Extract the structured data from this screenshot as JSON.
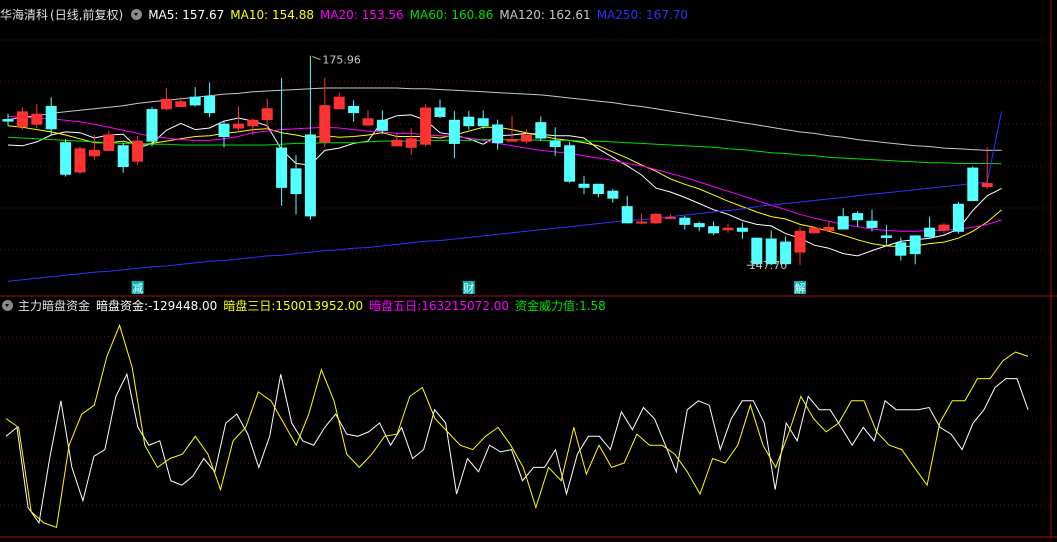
{
  "main_header": {
    "title": "华海清科",
    "mode": "(日线,前复权)",
    "indicators": [
      {
        "label": "MA5",
        "value": "157.67",
        "color": "#ffffff"
      },
      {
        "label": "MA10",
        "value": "154.88",
        "color": "#ffff00"
      },
      {
        "label": "MA20",
        "value": "153.56",
        "color": "#ff00ff"
      },
      {
        "label": "MA60",
        "value": "160.86",
        "color": "#00e000"
      },
      {
        "label": "MA120",
        "value": "162.61",
        "color": "#c8c8c8"
      },
      {
        "label": "MA250",
        "value": "167.70",
        "color": "#3030ff"
      }
    ]
  },
  "sub_header": {
    "title": "主力暗盘资金",
    "indicators": [
      {
        "label": "暗盘资金",
        "value": "-129448.00",
        "color": "#ffffff"
      },
      {
        "label": "暗盘三日",
        "value": "150013952.00",
        "color": "#ffff00"
      },
      {
        "label": "暗盘五日",
        "value": "163215072.00",
        "color": "#ff00ff"
      },
      {
        "label": "资金威力值",
        "value": "1.58",
        "color": "#00e000"
      }
    ]
  },
  "markers": [
    {
      "text": "减",
      "index": 9
    },
    {
      "text": "财",
      "index": 32
    },
    {
      "text": "解",
      "index": 55
    }
  ],
  "chart_data": [
    {
      "type": "candlestick",
      "high_annotation": "175.96",
      "low_annotation": "147.70",
      "ylim": [
        145.0,
        179.0
      ],
      "grid": true,
      "candles": [
        [
          166.6,
          166.4,
          167.4,
          165.8
        ],
        [
          165.7,
          167.6,
          168.2,
          165.3
        ],
        [
          166.0,
          167.3,
          168.6,
          165.5
        ],
        [
          168.3,
          165.4,
          169.5,
          164.5
        ],
        [
          163.6,
          159.5,
          164.1,
          159.2
        ],
        [
          159.8,
          162.8,
          163.1,
          159.5
        ],
        [
          161.9,
          162.6,
          164.6,
          161.4
        ],
        [
          162.6,
          164.6,
          165.1,
          162.5
        ],
        [
          163.2,
          160.5,
          163.6,
          159.7
        ],
        [
          161.2,
          163.8,
          164.5,
          160.7
        ],
        [
          167.9,
          163.8,
          168.2,
          163.1
        ],
        [
          168.0,
          169.2,
          170.7,
          167.8
        ],
        [
          168.3,
          168.9,
          169.5,
          168.3
        ],
        [
          169.5,
          168.5,
          170.8,
          168.3
        ],
        [
          169.6,
          167.5,
          171.4,
          166.9
        ],
        [
          166.0,
          164.4,
          166.5,
          163.0
        ],
        [
          165.5,
          166.0,
          168.3,
          164.9
        ],
        [
          165.8,
          166.5,
          166.8,
          164.6
        ],
        [
          166.6,
          168.0,
          169.3,
          165.3
        ],
        [
          162.9,
          157.8,
          172.0,
          155.4
        ],
        [
          160.2,
          157.0,
          162.0,
          154.3
        ],
        [
          164.6,
          154.1,
          174.9,
          153.6
        ],
        [
          163.7,
          168.4,
          172.0,
          163.0
        ],
        [
          168.0,
          169.5,
          170.1,
          167.9
        ],
        [
          168.3,
          167.5,
          169.1,
          166.3
        ],
        [
          165.9,
          166.7,
          167.8,
          165.7
        ],
        [
          166.5,
          165.2,
          167.8,
          164.7
        ],
        [
          163.2,
          163.9,
          164.9,
          163.1
        ],
        [
          163.0,
          164.1,
          165.5,
          162.0
        ],
        [
          163.4,
          168.1,
          168.6,
          163.1
        ],
        [
          168.1,
          167.0,
          169.2,
          166.8
        ],
        [
          166.5,
          163.5,
          167.7,
          161.6
        ],
        [
          166.9,
          165.8,
          167.7,
          165.3
        ],
        [
          166.7,
          165.8,
          167.8,
          165.4
        ],
        [
          165.9,
          163.6,
          166.6,
          162.7
        ],
        [
          163.8,
          164.0,
          167.1,
          164.1
        ],
        [
          163.8,
          164.6,
          165.4,
          163.5
        ],
        [
          166.2,
          164.2,
          167.0,
          163.8
        ],
        [
          163.8,
          163.1,
          165.6,
          161.9
        ],
        [
          163.2,
          158.6,
          163.7,
          158.4
        ],
        [
          158.2,
          157.8,
          159.3,
          156.9
        ],
        [
          158.2,
          157.0,
          158.2,
          156.5
        ],
        [
          157.3,
          156.4,
          157.6,
          155.8
        ],
        [
          155.3,
          153.2,
          156.7,
          153.1
        ],
        [
          153.2,
          153.3,
          154.4,
          153.0
        ],
        [
          153.2,
          154.3,
          154.5,
          153.0
        ],
        [
          153.9,
          153.9,
          154.3,
          153.7
        ],
        [
          153.8,
          153.0,
          154.1,
          152.3
        ],
        [
          153.1,
          152.7,
          153.3,
          152.1
        ],
        [
          152.7,
          151.9,
          153.4,
          151.6
        ],
        [
          152.3,
          152.5,
          153.1,
          151.9
        ],
        [
          152.5,
          152.1,
          153.2,
          151.1
        ],
        [
          151.2,
          147.9,
          151.3,
          147.7
        ],
        [
          151.1,
          147.9,
          152.2,
          147.7
        ],
        [
          150.7,
          147.9,
          151.4,
          147.7
        ],
        [
          149.4,
          152.1,
          152.7,
          147.7
        ],
        [
          151.9,
          152.5,
          152.7,
          151.8
        ],
        [
          152.2,
          152.6,
          153.3,
          152.1
        ],
        [
          154.0,
          152.4,
          155.1,
          152.4
        ],
        [
          154.4,
          153.6,
          154.7,
          152.7
        ],
        [
          153.4,
          152.6,
          154.9,
          152.1
        ],
        [
          151.5,
          151.3,
          152.9,
          150.3
        ],
        [
          150.6,
          149.0,
          151.3,
          148.3
        ],
        [
          151.5,
          149.2,
          151.5,
          147.8
        ],
        [
          152.5,
          151.4,
          154.0,
          151.1
        ],
        [
          152.3,
          152.9,
          153.2,
          151.8
        ],
        [
          155.6,
          152.1,
          155.9,
          151.8
        ],
        [
          160.3,
          156.1,
          160.5,
          156.1
        ],
        [
          157.9,
          158.3,
          163.0,
          157.6
        ]
      ],
      "ma_lines": [
        {
          "name": "MA5",
          "color": "#ffffff",
          "values": [
            163.3,
            163.2,
            163.7,
            164.6,
            165.0,
            164.9,
            164.2,
            164.6,
            164.7,
            162.9,
            163.5,
            165.2,
            166.1,
            165.3,
            165.5,
            166.4,
            166.8,
            166.4,
            165.8,
            162.7,
            160.9,
            160.7,
            162.6,
            162.9,
            163.5,
            163.8,
            166.4,
            167.1,
            167.2,
            166.5,
            164.9,
            164.6,
            164.1,
            163.4,
            164.5,
            164.6,
            164.8,
            164.7,
            164.5,
            164.5,
            164.2,
            162.8,
            161.7,
            160.6,
            159.4,
            157.7,
            157.2,
            156.5,
            155.7,
            154.9,
            154.3,
            153.5,
            153.0,
            152.8,
            151.8,
            151.2,
            150.3,
            149.9,
            149.2,
            148.9,
            149.6,
            150.2,
            150.8,
            151.0,
            151.2,
            151.6,
            152.4,
            154.8,
            156.7,
            157.67
          ]
        },
        {
          "name": "MA10",
          "color": "#ffff00",
          "values": [
            165.8,
            165.6,
            165.3,
            165.0,
            164.6,
            164.1,
            163.6,
            163.6,
            163.8,
            163.3,
            163.5,
            163.8,
            164.1,
            164.4,
            164.5,
            164.8,
            165.0,
            165.3,
            165.4,
            164.9,
            164.6,
            164.2,
            164.5,
            164.3,
            164.4,
            164.6,
            164.9,
            164.4,
            164.4,
            164.4,
            164.2,
            164.6,
            165.1,
            165.6,
            165.6,
            165.3,
            164.9,
            164.5,
            164.1,
            163.9,
            163.6,
            163.2,
            162.4,
            161.6,
            160.7,
            159.9,
            158.9,
            158.2,
            157.6,
            156.8,
            156.0,
            155.3,
            154.6,
            154.0,
            153.7,
            153.0,
            152.6,
            152.1,
            151.6,
            151.0,
            150.5,
            150.2,
            150.1,
            150.2,
            150.5,
            150.7,
            151.2,
            152.1,
            153.3,
            154.88
          ]
        },
        {
          "name": "MA20",
          "color": "#ff00ff",
          "values": [
            167.0,
            166.9,
            166.8,
            166.7,
            166.5,
            166.3,
            166.0,
            165.6,
            165.2,
            164.8,
            164.4,
            164.2,
            164.0,
            163.9,
            163.9,
            164.1,
            164.4,
            164.9,
            165.1,
            165.3,
            165.4,
            165.5,
            165.6,
            165.5,
            165.3,
            165.1,
            165.0,
            164.8,
            164.8,
            164.6,
            164.5,
            164.4,
            164.2,
            163.9,
            163.5,
            163.2,
            162.9,
            162.6,
            162.4,
            162.2,
            161.9,
            161.6,
            161.3,
            160.9,
            160.6,
            160.1,
            159.6,
            159.1,
            158.5,
            157.9,
            157.3,
            156.7,
            156.1,
            155.5,
            154.9,
            154.3,
            153.8,
            153.4,
            153.0,
            152.7,
            152.4,
            152.2,
            152.1,
            152.1,
            152.2,
            152.2,
            152.4,
            152.6,
            153.0,
            153.56
          ]
        },
        {
          "name": "MA60",
          "color": "#00e000",
          "values": [
            164.3,
            164.2,
            164.1,
            164.0,
            163.9,
            163.8,
            163.7,
            163.6,
            163.5,
            163.5,
            163.4,
            163.4,
            163.3,
            163.3,
            163.3,
            163.3,
            163.3,
            163.3,
            163.3,
            163.4,
            163.5,
            163.5,
            163.6,
            163.6,
            163.6,
            163.7,
            163.8,
            163.8,
            163.8,
            163.9,
            163.9,
            163.9,
            163.9,
            164.0,
            164.0,
            164.0,
            164.0,
            163.9,
            163.9,
            163.9,
            163.8,
            163.8,
            163.7,
            163.6,
            163.5,
            163.4,
            163.3,
            163.2,
            163.1,
            163.0,
            162.8,
            162.7,
            162.5,
            162.3,
            162.2,
            162.0,
            161.9,
            161.7,
            161.6,
            161.5,
            161.4,
            161.3,
            161.2,
            161.1,
            161.0,
            161.0,
            160.9,
            160.9,
            160.9,
            160.86
          ]
        },
        {
          "name": "MA120",
          "color": "#c8c8c8",
          "values": [
            166.6,
            166.9,
            167.1,
            167.4,
            167.6,
            167.8,
            168.0,
            168.2,
            168.4,
            168.7,
            168.9,
            169.1,
            169.3,
            169.5,
            169.7,
            169.9,
            170.0,
            170.2,
            170.3,
            170.4,
            170.5,
            170.6,
            170.7,
            170.7,
            170.7,
            170.7,
            170.7,
            170.7,
            170.6,
            170.6,
            170.5,
            170.4,
            170.3,
            170.2,
            170.1,
            170.0,
            169.9,
            169.8,
            169.6,
            169.4,
            169.2,
            169.0,
            168.8,
            168.5,
            168.3,
            168.0,
            167.7,
            167.4,
            167.1,
            166.8,
            166.5,
            166.2,
            165.9,
            165.6,
            165.3,
            165.0,
            164.8,
            164.5,
            164.3,
            164.0,
            163.8,
            163.6,
            163.4,
            163.2,
            163.1,
            162.9,
            162.8,
            162.7,
            162.6,
            162.61
          ]
        },
        {
          "name": "MA250",
          "color": "#3030ff",
          "values": [
            145.6,
            145.8,
            146.0,
            146.2,
            146.4,
            146.6,
            146.8,
            146.9,
            147.1,
            147.3,
            147.5,
            147.6,
            147.8,
            148.0,
            148.2,
            148.3,
            148.5,
            148.7,
            148.9,
            149.0,
            149.2,
            149.4,
            149.6,
            149.7,
            149.9,
            150.0,
            150.2,
            150.4,
            150.6,
            150.8,
            150.9,
            151.1,
            151.3,
            151.5,
            151.7,
            151.9,
            152.1,
            152.3,
            152.5,
            152.7,
            152.9,
            153.1,
            153.3,
            153.5,
            153.6,
            153.8,
            154.0,
            154.2,
            154.4,
            154.6,
            154.8,
            155.0,
            155.3,
            155.5,
            155.7,
            155.9,
            156.1,
            156.3,
            156.5,
            156.7,
            156.9,
            157.1,
            157.3,
            157.5,
            157.7,
            157.9,
            158.1,
            158.3,
            158.5,
            167.7
          ]
        }
      ]
    },
    {
      "type": "line",
      "ylim": [
        0,
        100
      ],
      "grid": true,
      "series": [
        {
          "name": "暗盘资金",
          "color": "#ffffff",
          "values": [
            44,
            48,
            12,
            5,
            35,
            60,
            30,
            15,
            35,
            38,
            62,
            72,
            48,
            40,
            42,
            24,
            22,
            26,
            34,
            28,
            50,
            54,
            45,
            30,
            44,
            72,
            50,
            42,
            40,
            48,
            54,
            45,
            44,
            46,
            50,
            40,
            48,
            34,
            38,
            56,
            50,
            18,
            34,
            28,
            40,
            37,
            38,
            24,
            30,
            30,
            38,
            18,
            36,
            44,
            44,
            38,
            55,
            47,
            57,
            52,
            40,
            28,
            56,
            60,
            58,
            38,
            52,
            60,
            60,
            50,
            20,
            50,
            42,
            62,
            56,
            56,
            48,
            40,
            48,
            42,
            60,
            56,
            56,
            56,
            57,
            48,
            45,
            38,
            50,
            56,
            66,
            70,
            70,
            56
          ]
        },
        {
          "name": "暗盘三日",
          "color": "#ffff00",
          "values": [
            52,
            48,
            10,
            5,
            3,
            40,
            54,
            58,
            80,
            94,
            75,
            40,
            30,
            34,
            36,
            44,
            36,
            20,
            42,
            48,
            64,
            60,
            50,
            40,
            54,
            74,
            60,
            36,
            30,
            36,
            44,
            45,
            62,
            66,
            52,
            46,
            40,
            38,
            44,
            48,
            40,
            30,
            12,
            30,
            24,
            48,
            27,
            40,
            30,
            32,
            45,
            40,
            40,
            36,
            28,
            18,
            34,
            32,
            40,
            58,
            40,
            30,
            45,
            62,
            52,
            46,
            50,
            60,
            60,
            46,
            40,
            38,
            30,
            22,
            50,
            60,
            60,
            70,
            70,
            78,
            82,
            80
          ]
        }
      ]
    }
  ]
}
